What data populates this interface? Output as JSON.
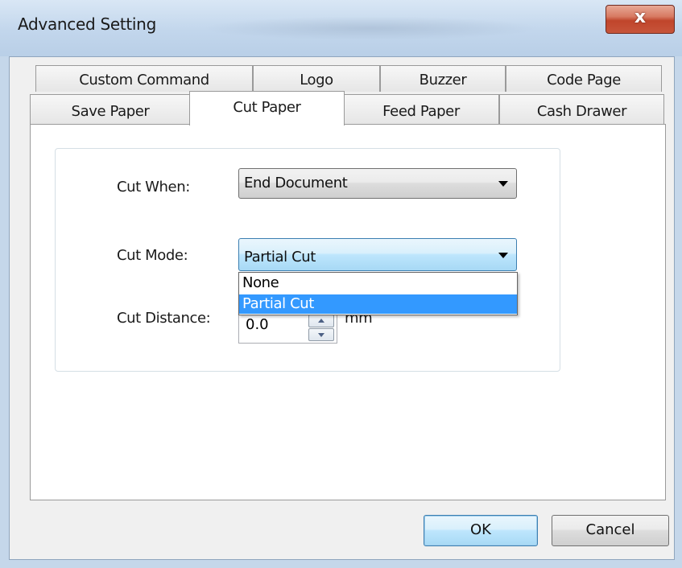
{
  "window": {
    "title": "Advanced Setting",
    "close_glyph": "x"
  },
  "tabs": {
    "row1": [
      {
        "label": "Custom Command"
      },
      {
        "label": "Logo"
      },
      {
        "label": "Buzzer"
      },
      {
        "label": "Code Page"
      }
    ],
    "row2": [
      {
        "label": "Save Paper"
      },
      {
        "label": "Cut Paper"
      },
      {
        "label": "Feed Paper"
      },
      {
        "label": "Cash Drawer"
      }
    ],
    "selected": "Cut Paper"
  },
  "form": {
    "cut_when": {
      "label": "Cut When:",
      "value": "End Document"
    },
    "cut_mode": {
      "label": "Cut Mode:",
      "value": "Partial Cut",
      "options": [
        "None",
        "Partial Cut"
      ],
      "highlighted": "Partial Cut"
    },
    "cut_distance": {
      "label": "Cut Distance:",
      "value": "0.0",
      "unit": "mm"
    }
  },
  "buttons": {
    "ok": "OK",
    "cancel": "Cancel"
  },
  "colors": {
    "selection": "#3399ff",
    "close_button": "#c7553a",
    "focus_border": "#3c7fb1"
  }
}
